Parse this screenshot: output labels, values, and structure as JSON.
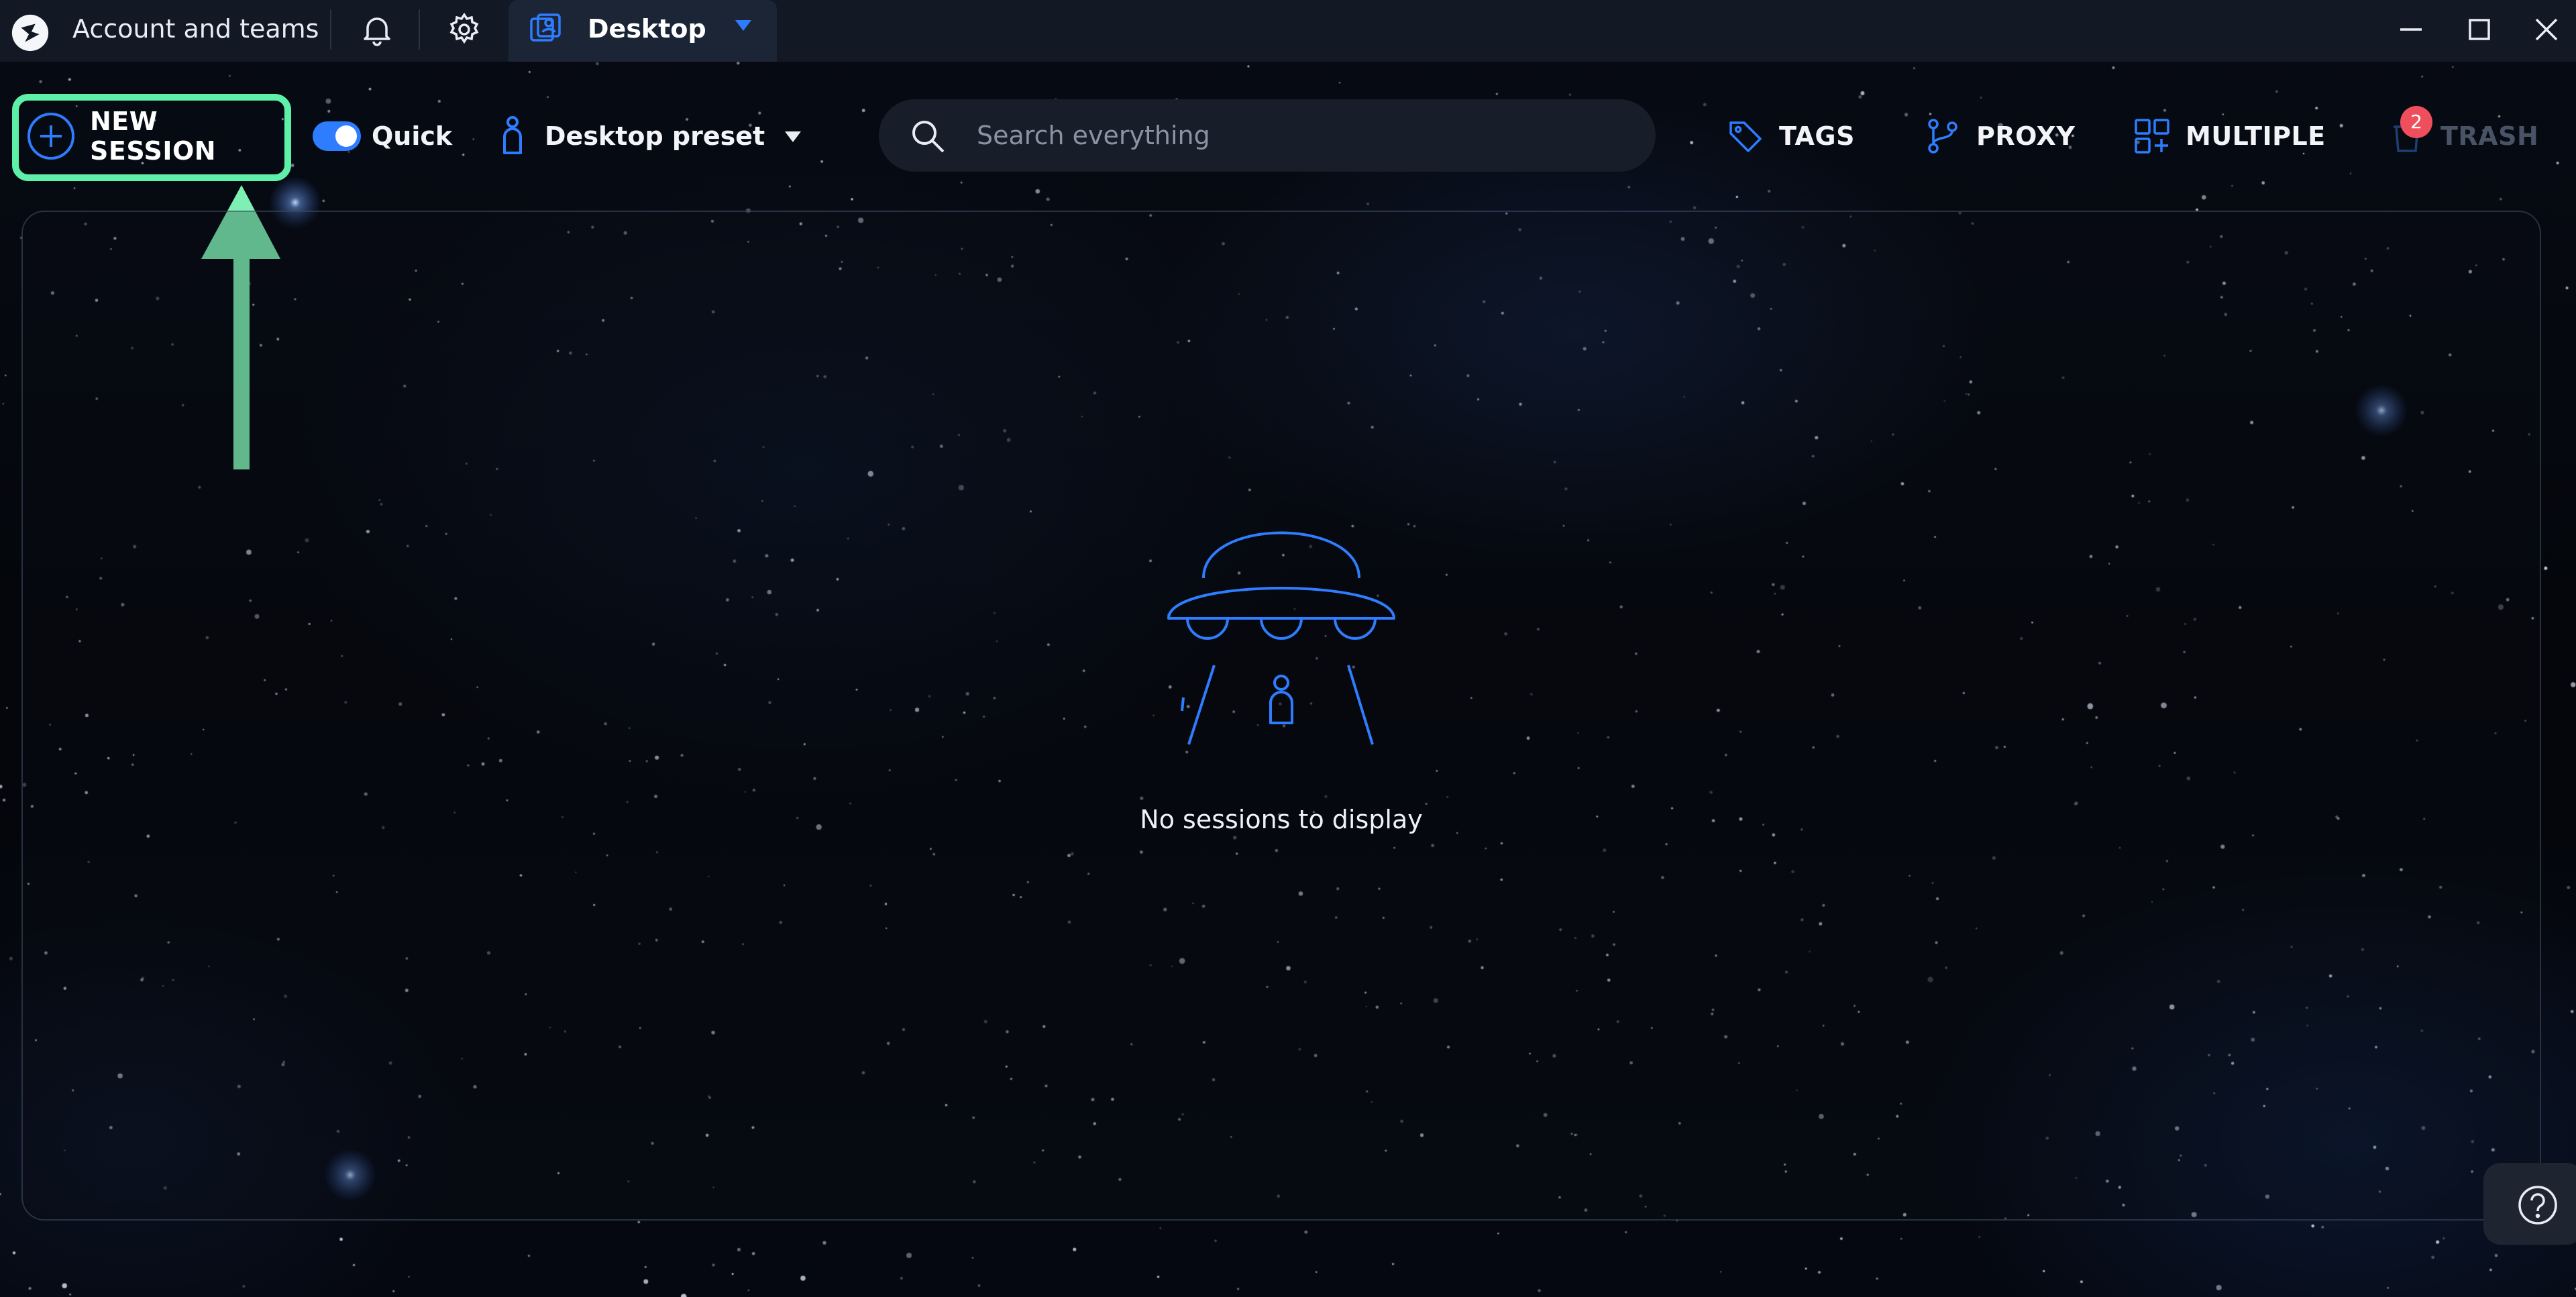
{
  "titlebar": {
    "account_label": "Account and teams",
    "tab_label": "Desktop",
    "icons": [
      "app-logo-icon",
      "bell-icon",
      "gear-icon",
      "desktop-profile-icon",
      "chevron-down-icon",
      "minimize-icon",
      "maximize-icon",
      "close-icon"
    ]
  },
  "toolbar": {
    "new_session_label": "NEW SESSION",
    "quick_label": "Quick",
    "quick_enabled": true,
    "preset_label": "Desktop preset",
    "search_placeholder": "Search everything",
    "tags_label": "TAGS",
    "proxy_label": "PROXY",
    "multiple_label": "MULTIPLE",
    "trash_label": "TRASH",
    "trash_badge": "2"
  },
  "main": {
    "empty_message": "No sessions to display"
  },
  "colors": {
    "accent": "#2f7dff",
    "highlight": "#5ef0a8",
    "badge": "#ef4f5c",
    "titlebar": "#121925"
  }
}
